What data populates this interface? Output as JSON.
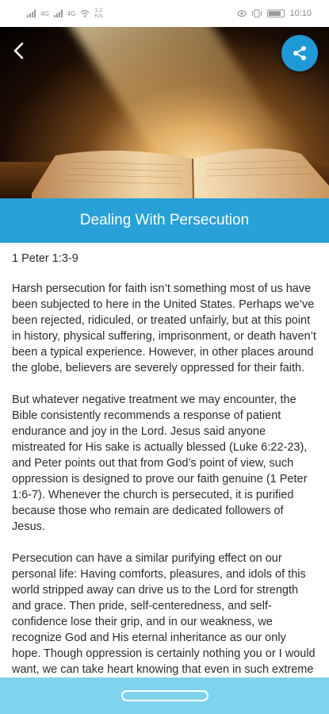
{
  "status_bar": {
    "network_left": "4G",
    "network_right": "4G",
    "speed": "1.2 K/s",
    "time": "10:10",
    "icons": [
      "signal-icon",
      "wifi-icon",
      "vibrate-icon",
      "eye-icon",
      "battery-icon"
    ]
  },
  "header": {
    "back_icon": "chevron-left-icon",
    "share_icon": "share-icon",
    "accent_color": "#28a0d8"
  },
  "article": {
    "title": "Dealing With Persecution",
    "reference": "1 Peter 1:3-9",
    "paragraphs": [
      "Harsh persecution for faith isn’t something most of us have been subjected to here in the United States. Perhaps we’ve been rejected, ridiculed, or treated unfairly, but at this point in history, physical suffering, imprisonment, or death haven’t been a typical experience. However, in other places around the globe, believers are severely oppressed for their faith.",
      "But whatever negative treatment we may encounter, the Bible consistently recommends a response of patient endurance and joy in the Lord. Jesus said anyone mistreated for His sake is actually blessed (Luke 6:22-23), and Peter points out that from God’s point of view, such oppression is designed to prove our faith genuine (1 Peter 1:6-7). Whenever the church is persecuted, it is purified because those who remain are dedicated followers of Jesus.",
      "Persecution can have a similar purifying effect on our personal life: Having comforts, pleasures, and idols of this world stripped away can drive us to the Lord for strength and grace. Then pride, self-centeredness, and self-confidence lose their grip, and in our weakness, we recognize God and His eternal inheritance as our only hope. Though oppression is certainly nothing you or I would want, we can take heart knowing that even in such extreme situations, there are blessings that lead"
    ]
  }
}
